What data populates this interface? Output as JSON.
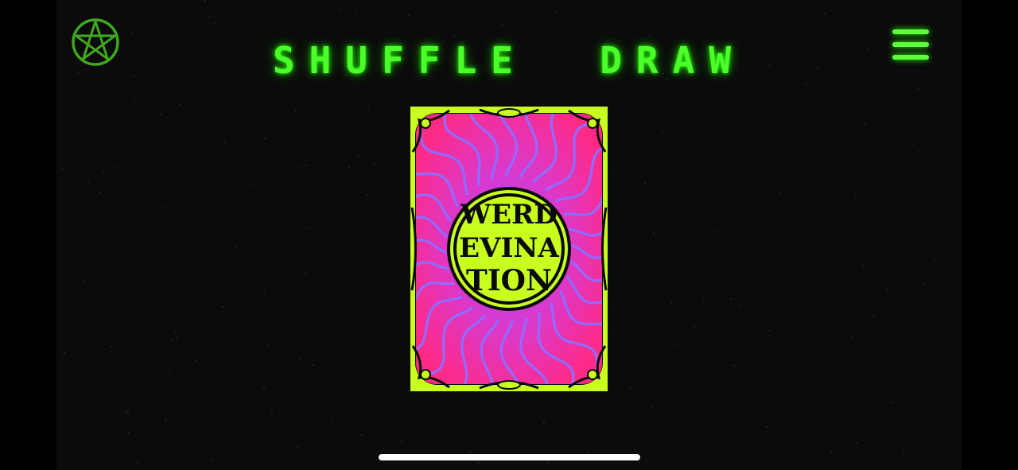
{
  "app": {
    "title": "SHUFFLE  DRAW"
  },
  "toolbar": {
    "left_icon": "pentagram-icon",
    "right_icon": "hamburger-menu-icon"
  },
  "card": {
    "side": "back",
    "logo_lines": [
      "WERD",
      "EVINA",
      "TION"
    ]
  },
  "colors": {
    "neon_green": "#4bff2b",
    "card_frame": "#c8ff1e",
    "card_pink": "#ff2d8a",
    "card_violet": "#8a5cff",
    "background": "#0b0b0b"
  }
}
